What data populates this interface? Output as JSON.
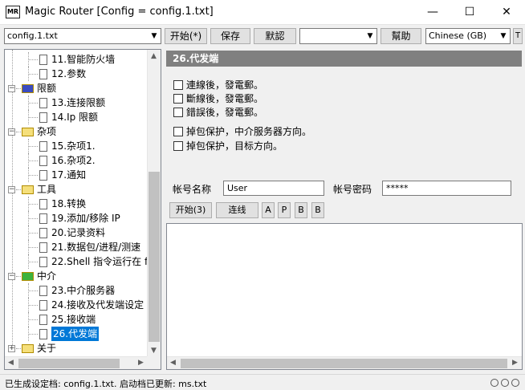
{
  "window": {
    "icon_text": "MR",
    "title": "Magic Router [Config = config.1.txt]",
    "min_glyph": "—",
    "max_glyph": "☐",
    "close_glyph": "✕"
  },
  "toolbar": {
    "config_select_value": "config.1.txt",
    "start_label": "开始(*)",
    "save_label": "保存",
    "default_label": "默認",
    "blank_select_value": "",
    "help_label": "幫助",
    "language_select_value": "Chinese (GB)",
    "extra_label": "T",
    "dropdown_glyph": "▼"
  },
  "tree": {
    "items": [
      {
        "label": "11.智能防火墙",
        "type": "leaf"
      },
      {
        "label": "12.参数",
        "type": "leaf"
      },
      {
        "label": "限额",
        "type": "folder",
        "color": "#3b4cc0",
        "expander": "−"
      },
      {
        "label": "13.连接限额",
        "type": "leaf"
      },
      {
        "label": "14.Ip 限额",
        "type": "leaf"
      },
      {
        "label": "杂项",
        "type": "folder",
        "color": "#f5df7b",
        "expander": "−"
      },
      {
        "label": "15.杂项1.",
        "type": "leaf"
      },
      {
        "label": "16.杂项2.",
        "type": "leaf"
      },
      {
        "label": "17.通知",
        "type": "leaf"
      },
      {
        "label": "工具",
        "type": "folder",
        "color": "#f5df7b",
        "expander": "−"
      },
      {
        "label": "18.转换",
        "type": "leaf"
      },
      {
        "label": "19.添加/移除 IP",
        "type": "leaf"
      },
      {
        "label": "20.记录资料",
        "type": "leaf"
      },
      {
        "label": "21.数据包/进程/测速",
        "type": "leaf"
      },
      {
        "label": "22.Shell 指令运行在 f",
        "type": "leaf"
      },
      {
        "label": "中介",
        "type": "folder",
        "color": "#3db23d",
        "expander": "−"
      },
      {
        "label": "23.中介服务器",
        "type": "leaf"
      },
      {
        "label": "24.接收及代发端设定",
        "type": "leaf"
      },
      {
        "label": "25.接收端",
        "type": "leaf"
      },
      {
        "label": "26.代发端",
        "type": "leaf",
        "selected": true
      },
      {
        "label": "关于",
        "type": "folder",
        "color": "#f5df7b",
        "expander": "+"
      }
    ],
    "scroll_up": "▲",
    "scroll_down": "▼",
    "scroll_left": "◀",
    "scroll_right": "▶"
  },
  "panel": {
    "title": "26.代发端",
    "checkboxes": [
      {
        "label": "連線後，發電郵。",
        "checked": false
      },
      {
        "label": "斷線後，發電郵。",
        "checked": false
      },
      {
        "label": "錯誤後，發電郵。",
        "checked": false
      },
      {
        "label": "掉包保护，中介服务器方向。",
        "checked": false
      },
      {
        "label": "掉包保护，目标方向。",
        "checked": false
      }
    ],
    "account_name_label": "帐号名称",
    "account_name_value": "User",
    "account_password_label": "帐号密码",
    "account_password_value": "*****",
    "start_button": "开始(3)",
    "connect_button": "连线",
    "btn_a": "A",
    "btn_p": "P",
    "btn_b1": "B",
    "btn_b2": "B"
  },
  "log": {
    "scroll_left": "◀",
    "scroll_right": "▶"
  },
  "status": {
    "text": "已生成设定档: config.1.txt. 启动档已更新: ms.txt"
  }
}
